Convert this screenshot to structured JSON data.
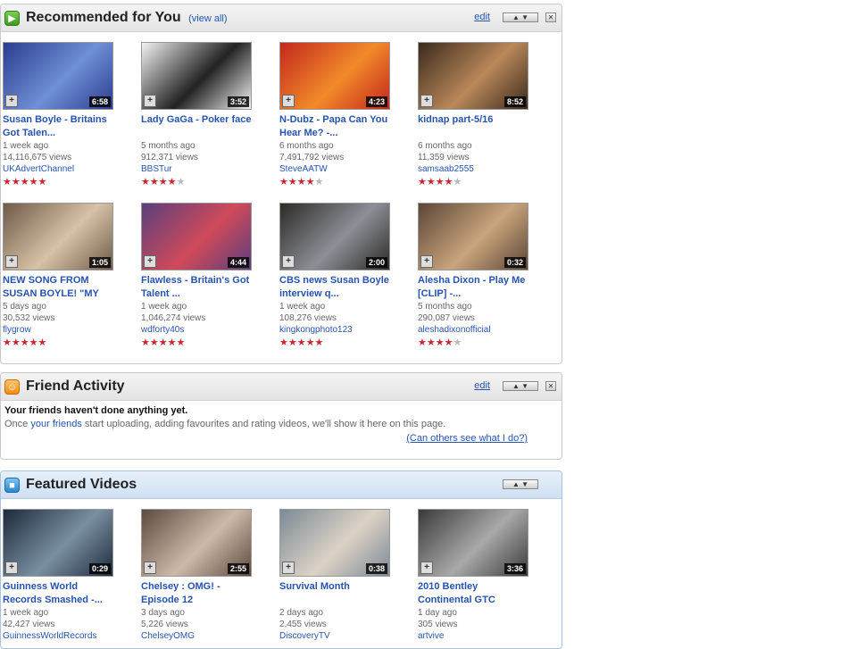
{
  "recommended": {
    "title": "Recommended for You",
    "view_all": "(view all)",
    "edit": "edit",
    "videos": [
      {
        "title": "Susan Boyle - Britains Got Talen...",
        "age": "1 week ago",
        "views": "14,116,675 views",
        "user": "UKAdvertChannel",
        "duration": "6:58",
        "rating": 5,
        "thumb_colors": [
          "#2a3d8e",
          "#6f8fd6"
        ]
      },
      {
        "title": "Lady GaGa - Poker face",
        "age": "5 months ago",
        "views": "912,371 views",
        "user": "BBSTur",
        "duration": "3:52",
        "rating": 4,
        "thumb_colors": [
          "#f2f2f2",
          "#222222"
        ]
      },
      {
        "title": "N-Dubz - Papa Can You Hear Me? -...",
        "age": "6 months ago",
        "views": "7,491,792 views",
        "user": "SteveAATW",
        "duration": "4:23",
        "rating": 4,
        "thumb_colors": [
          "#c3271c",
          "#f28a2a"
        ]
      },
      {
        "title": "kidnap part-5/16",
        "age": "6 months ago",
        "views": "11,359 views",
        "user": "samsaab2555",
        "duration": "8:52",
        "rating": 4,
        "thumb_colors": [
          "#3b2a1c",
          "#b9885a"
        ]
      },
      {
        "title": "NEW SONG FROM SUSAN BOYLE! \"MY",
        "age": "5 days ago",
        "views": "30,532 views",
        "user": "flygrow",
        "duration": "1:05",
        "rating": 5,
        "thumb_colors": [
          "#6e5a48",
          "#d8c2a6"
        ]
      },
      {
        "title": "Flawless - Britain's Got Talent ...",
        "age": "1 week ago",
        "views": "1,046,274 views",
        "user": "wdforty40s",
        "duration": "4:44",
        "rating": 5,
        "thumb_colors": [
          "#5a3f7c",
          "#d04a5a"
        ]
      },
      {
        "title": "CBS news Susan Boyle interview q...",
        "age": "1 week ago",
        "views": "108,276 views",
        "user": "kingkongphoto123",
        "duration": "2:00",
        "rating": 5,
        "thumb_colors": [
          "#2d2a27",
          "#8c8f96"
        ]
      },
      {
        "title": "Alesha Dixon - Play Me [CLIP] -...",
        "age": "5 months ago",
        "views": "290,087 views",
        "user": "aleshadixonofficial",
        "duration": "0:32",
        "rating": 4,
        "thumb_colors": [
          "#5a4637",
          "#c9a47c"
        ]
      }
    ]
  },
  "friend": {
    "title": "Friend Activity",
    "edit": "edit",
    "bold": "Your friends haven't done anything yet.",
    "pre": "Once ",
    "link": "your friends",
    "post": " start uploading, adding favourites and rating videos, we'll show it here on this page.",
    "help": "(Can others see what I do?)"
  },
  "featured": {
    "title": "Featured Videos",
    "videos": [
      {
        "title": "Guinness World Records Smashed -...",
        "age": "1 week ago",
        "views": "42,427 views",
        "user": "GuinnessWorldRecords",
        "duration": "0:29",
        "thumb_colors": [
          "#1c2b3c",
          "#7a8fa2"
        ]
      },
      {
        "title": "Chelsey : OMG! - Episode 12",
        "age": "3 days ago",
        "views": "5,226 views",
        "user": "ChelseyOMG",
        "duration": "2:55",
        "thumb_colors": [
          "#5d4a3f",
          "#cdb9a8"
        ]
      },
      {
        "title": "Survival Month",
        "age": "2 days ago",
        "views": "2,455 views",
        "user": "DiscoveryTV",
        "duration": "0:38",
        "thumb_colors": [
          "#7c8a96",
          "#dcd2c6"
        ]
      },
      {
        "title": "2010 Bentley Continental GTC",
        "age": "1 day ago",
        "views": "305 views",
        "user": "artvive",
        "duration": "3:36",
        "thumb_colors": [
          "#3a3a3a",
          "#a9a9a9"
        ]
      }
    ]
  },
  "colors": {
    "link": "#2653b0",
    "star": "#c9272e"
  }
}
